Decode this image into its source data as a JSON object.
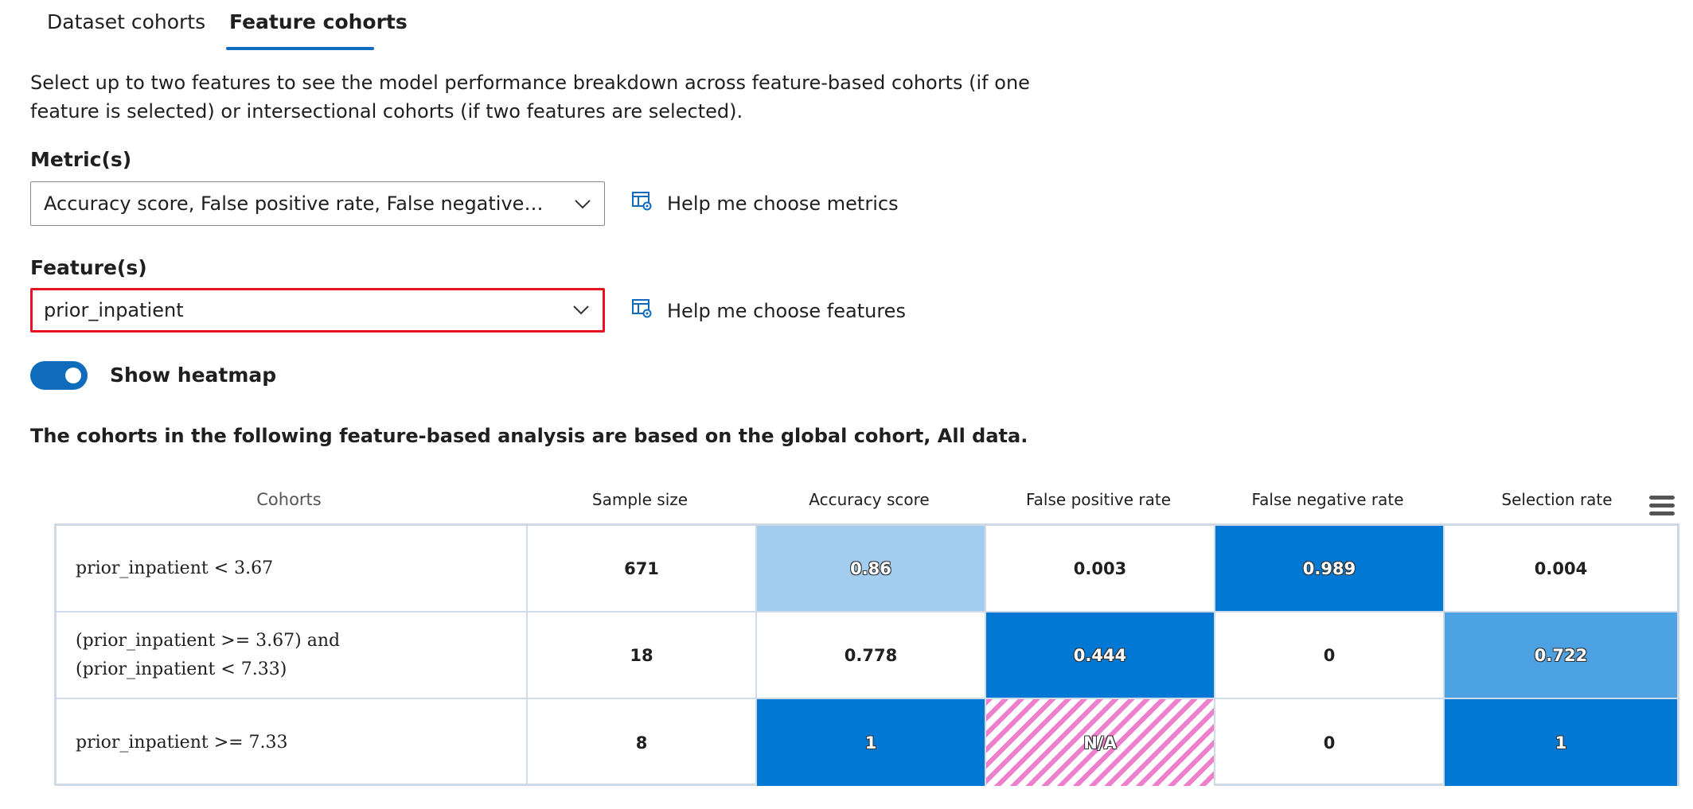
{
  "tabs": [
    {
      "label": "Dataset cohorts",
      "active": false
    },
    {
      "label": "Feature cohorts",
      "active": true
    }
  ],
  "description": "Select up to two features to see the model performance breakdown across feature-based cohorts (if one feature is selected) or intersectional cohorts (if two features are selected).",
  "metrics": {
    "label": "Metric(s)",
    "value": "Accuracy score, False positive rate, False negative rate, S...",
    "help": "Help me choose metrics"
  },
  "features": {
    "label": "Feature(s)",
    "value": "prior_inpatient",
    "help": "Help me choose features"
  },
  "heatmap_toggle": {
    "label": "Show heatmap",
    "on": true
  },
  "note": "The cohorts in the following feature-based analysis are based on the global cohort, All data.",
  "table": {
    "columns": [
      "Cohorts",
      "Sample size",
      "Accuracy score",
      "False positive rate",
      "False negative rate",
      "Selection rate"
    ],
    "rows": [
      {
        "cohort_line1": "prior_inpatient < 3.67",
        "cohort_line2": "",
        "sample_size": "671",
        "accuracy": "0.86",
        "fpr": "0.003",
        "fnr": "0.989",
        "selection": "0.004"
      },
      {
        "cohort_line1": "(prior_inpatient >= 3.67) and",
        "cohort_line2": "(prior_inpatient < 7.33)",
        "sample_size": "18",
        "accuracy": "0.778",
        "fpr": "0.444",
        "fnr": "0",
        "selection": "0.722"
      },
      {
        "cohort_line1": "prior_inpatient >= 7.33",
        "cohort_line2": "",
        "sample_size": "8",
        "accuracy": "1",
        "fpr": "N/A",
        "fnr": "0",
        "selection": "1"
      }
    ]
  },
  "colors": {
    "accent": "#0f6cbd",
    "heat_dark": "#0078d4",
    "heat_medium": "#4ba1e2",
    "heat_light": "#a3cdef",
    "na_hatch": "#ee7fcd",
    "highlight_border": "#e81123"
  }
}
